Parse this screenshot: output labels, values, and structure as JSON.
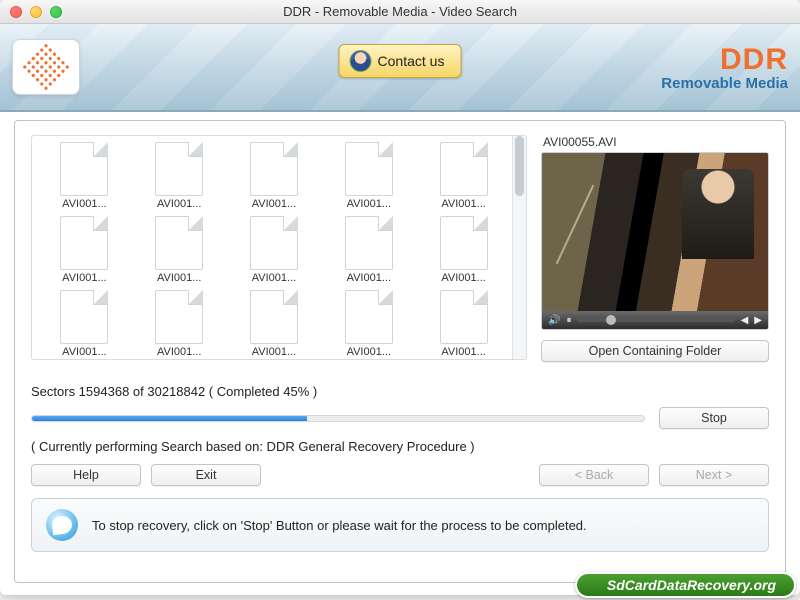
{
  "window": {
    "title": "DDR - Removable Media - Video Search"
  },
  "header": {
    "contact_label": "Contact us",
    "brand_main": "DDR",
    "brand_sub": "Removable Media"
  },
  "files": [
    {
      "name": "AVI001..."
    },
    {
      "name": "AVI001..."
    },
    {
      "name": "AVI001..."
    },
    {
      "name": "AVI001..."
    },
    {
      "name": "AVI001..."
    },
    {
      "name": "AVI001..."
    },
    {
      "name": "AVI001..."
    },
    {
      "name": "AVI001..."
    },
    {
      "name": "AVI001..."
    },
    {
      "name": "AVI001..."
    },
    {
      "name": "AVI001..."
    },
    {
      "name": "AVI001..."
    },
    {
      "name": "AVI001..."
    },
    {
      "name": "AVI001..."
    },
    {
      "name": "AVI001..."
    }
  ],
  "preview": {
    "filename": "AVI00055.AVI",
    "open_folder_label": "Open Containing Folder"
  },
  "progress": {
    "sectors_done": 1594368,
    "sectors_total": 30218842,
    "percent": 45,
    "label": "Sectors 1594368 of 30218842    ( Completed 45% )",
    "stop_label": "Stop",
    "status_line": "( Currently performing Search based on: DDR General Recovery Procedure )"
  },
  "buttons": {
    "help": "Help",
    "exit": "Exit",
    "back": "< Back",
    "next": "Next >"
  },
  "hint": {
    "text": "To stop recovery, click on 'Stop' Button or please wait for the process to be completed."
  },
  "watermark": "SdCardDataRecovery.org"
}
